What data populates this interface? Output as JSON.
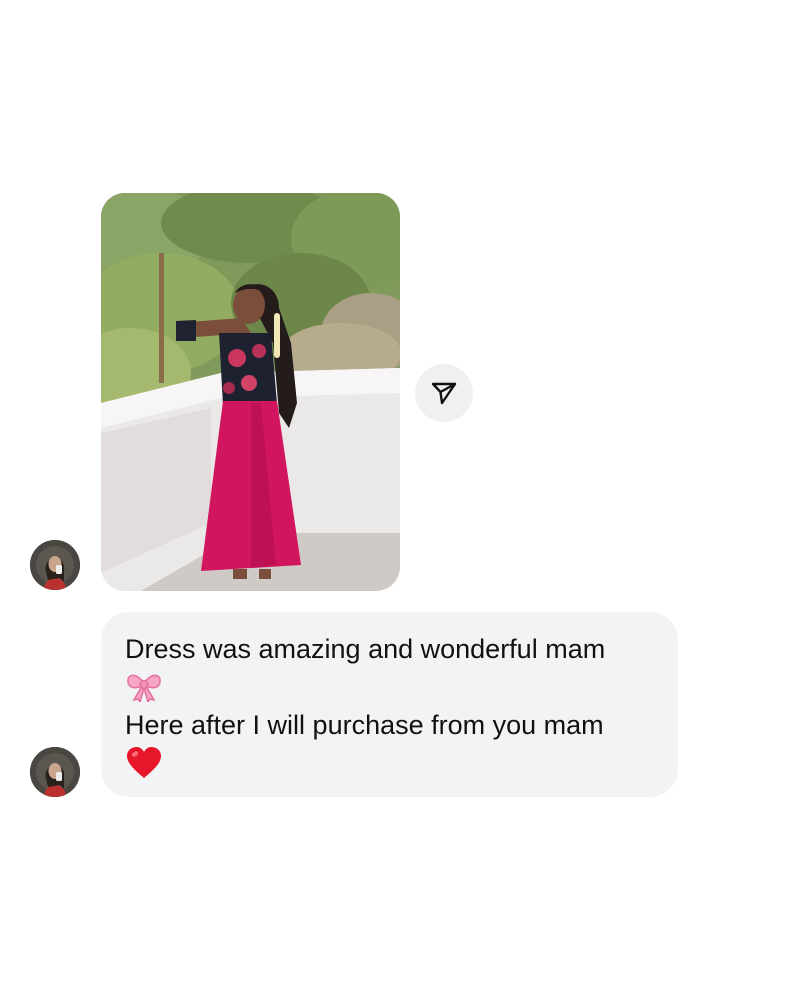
{
  "conversation": {
    "photo_message": {
      "image": "photo of a woman in a pink skirt and floral black blouse standing on a terrace with trees behind",
      "sender_avatar_icon": "profile-avatar-icon",
      "share_icon": "paper-plane-share-icon"
    },
    "text_message": {
      "line_1": "Dress was amazing and wonderful mam",
      "emoji_1": "🎀",
      "line_2": "Here after I will purchase from you mam",
      "emoji_2": "❤️",
      "sender_avatar_icon": "profile-avatar-icon"
    }
  },
  "colors": {
    "bubble_background": "#f2f3f5",
    "share_button_background": "#f0f0f2",
    "text": "#111111"
  }
}
